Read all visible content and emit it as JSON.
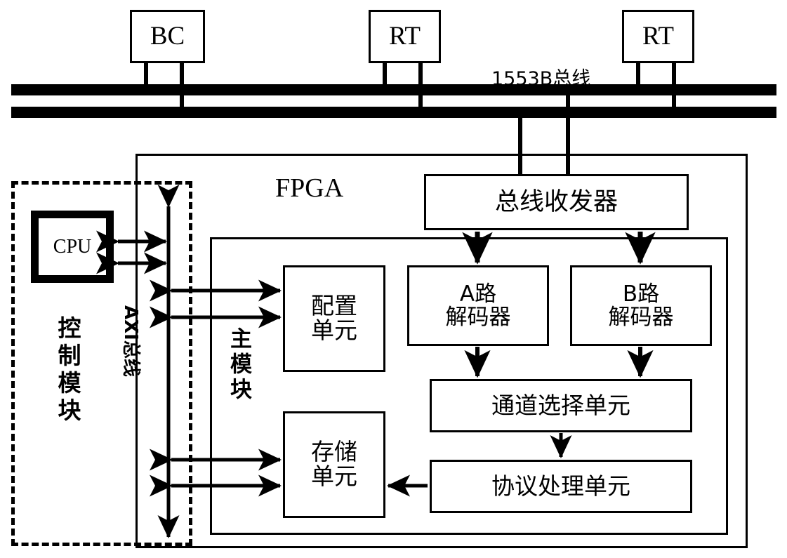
{
  "diagram": {
    "title_fpga": "FPGA",
    "bus_label": "1553B总线",
    "terminals": [
      {
        "id": "bc",
        "label": "BC"
      },
      {
        "id": "rt1",
        "label": "RT"
      },
      {
        "id": "rt2",
        "label": "RT"
      }
    ],
    "control_module": {
      "label": "控制模块",
      "cpu_label": "CPU"
    },
    "axi_bus_label": "AXI总线",
    "main_module_label": "主模块",
    "blocks": {
      "transceiver": "总线收发器",
      "decoder_a_line1": "A路",
      "decoder_a_line2": "解码器",
      "decoder_b_line1": "B路",
      "decoder_b_line2": "解码器",
      "channel_select": "通道选择单元",
      "protocol_unit": "协议处理单元",
      "config_line1": "配置",
      "config_line2": "单元",
      "storage_line1": "存储",
      "storage_line2": "单元"
    },
    "colors": {
      "stroke": "#000000",
      "background": "#ffffff"
    }
  }
}
